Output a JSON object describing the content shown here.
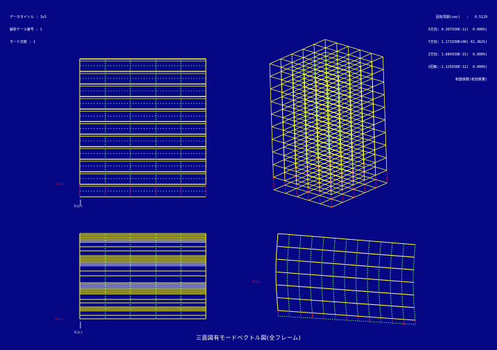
{
  "header_left": [
    {
      "key": "データタイトル",
      "val": ": 3x5"
    },
    {
      "key": "解析ケース番号",
      "val": ": 1"
    },
    {
      "key": "モード次数",
      "val": ": 1"
    }
  ],
  "header_right": [
    "固有周期(sec)   :   0.5129",
    "X方向: 0.307936E-12(  0.000%)",
    "Y方向: 1.171930E+00( 61.362%)",
    "Z方向: 1.684939E-15(  0.000%)",
    "X回転:-1.125838E-12(  0.000%)",
    "刺激係数(有効質量)"
  ],
  "level_labels": [
    "FL1(-)",
    "FL1(-)",
    "FL1(-)"
  ],
  "axis_labels": [
    "FL1(-)",
    "FL1(-)"
  ],
  "caption": "三面図有モードベクトル図(全フレーム)",
  "colors": {
    "background": "#050785",
    "frame": "#ffff33",
    "deformed": "#7dff5a",
    "support": "#ff3060",
    "text": "#ffffff"
  }
}
